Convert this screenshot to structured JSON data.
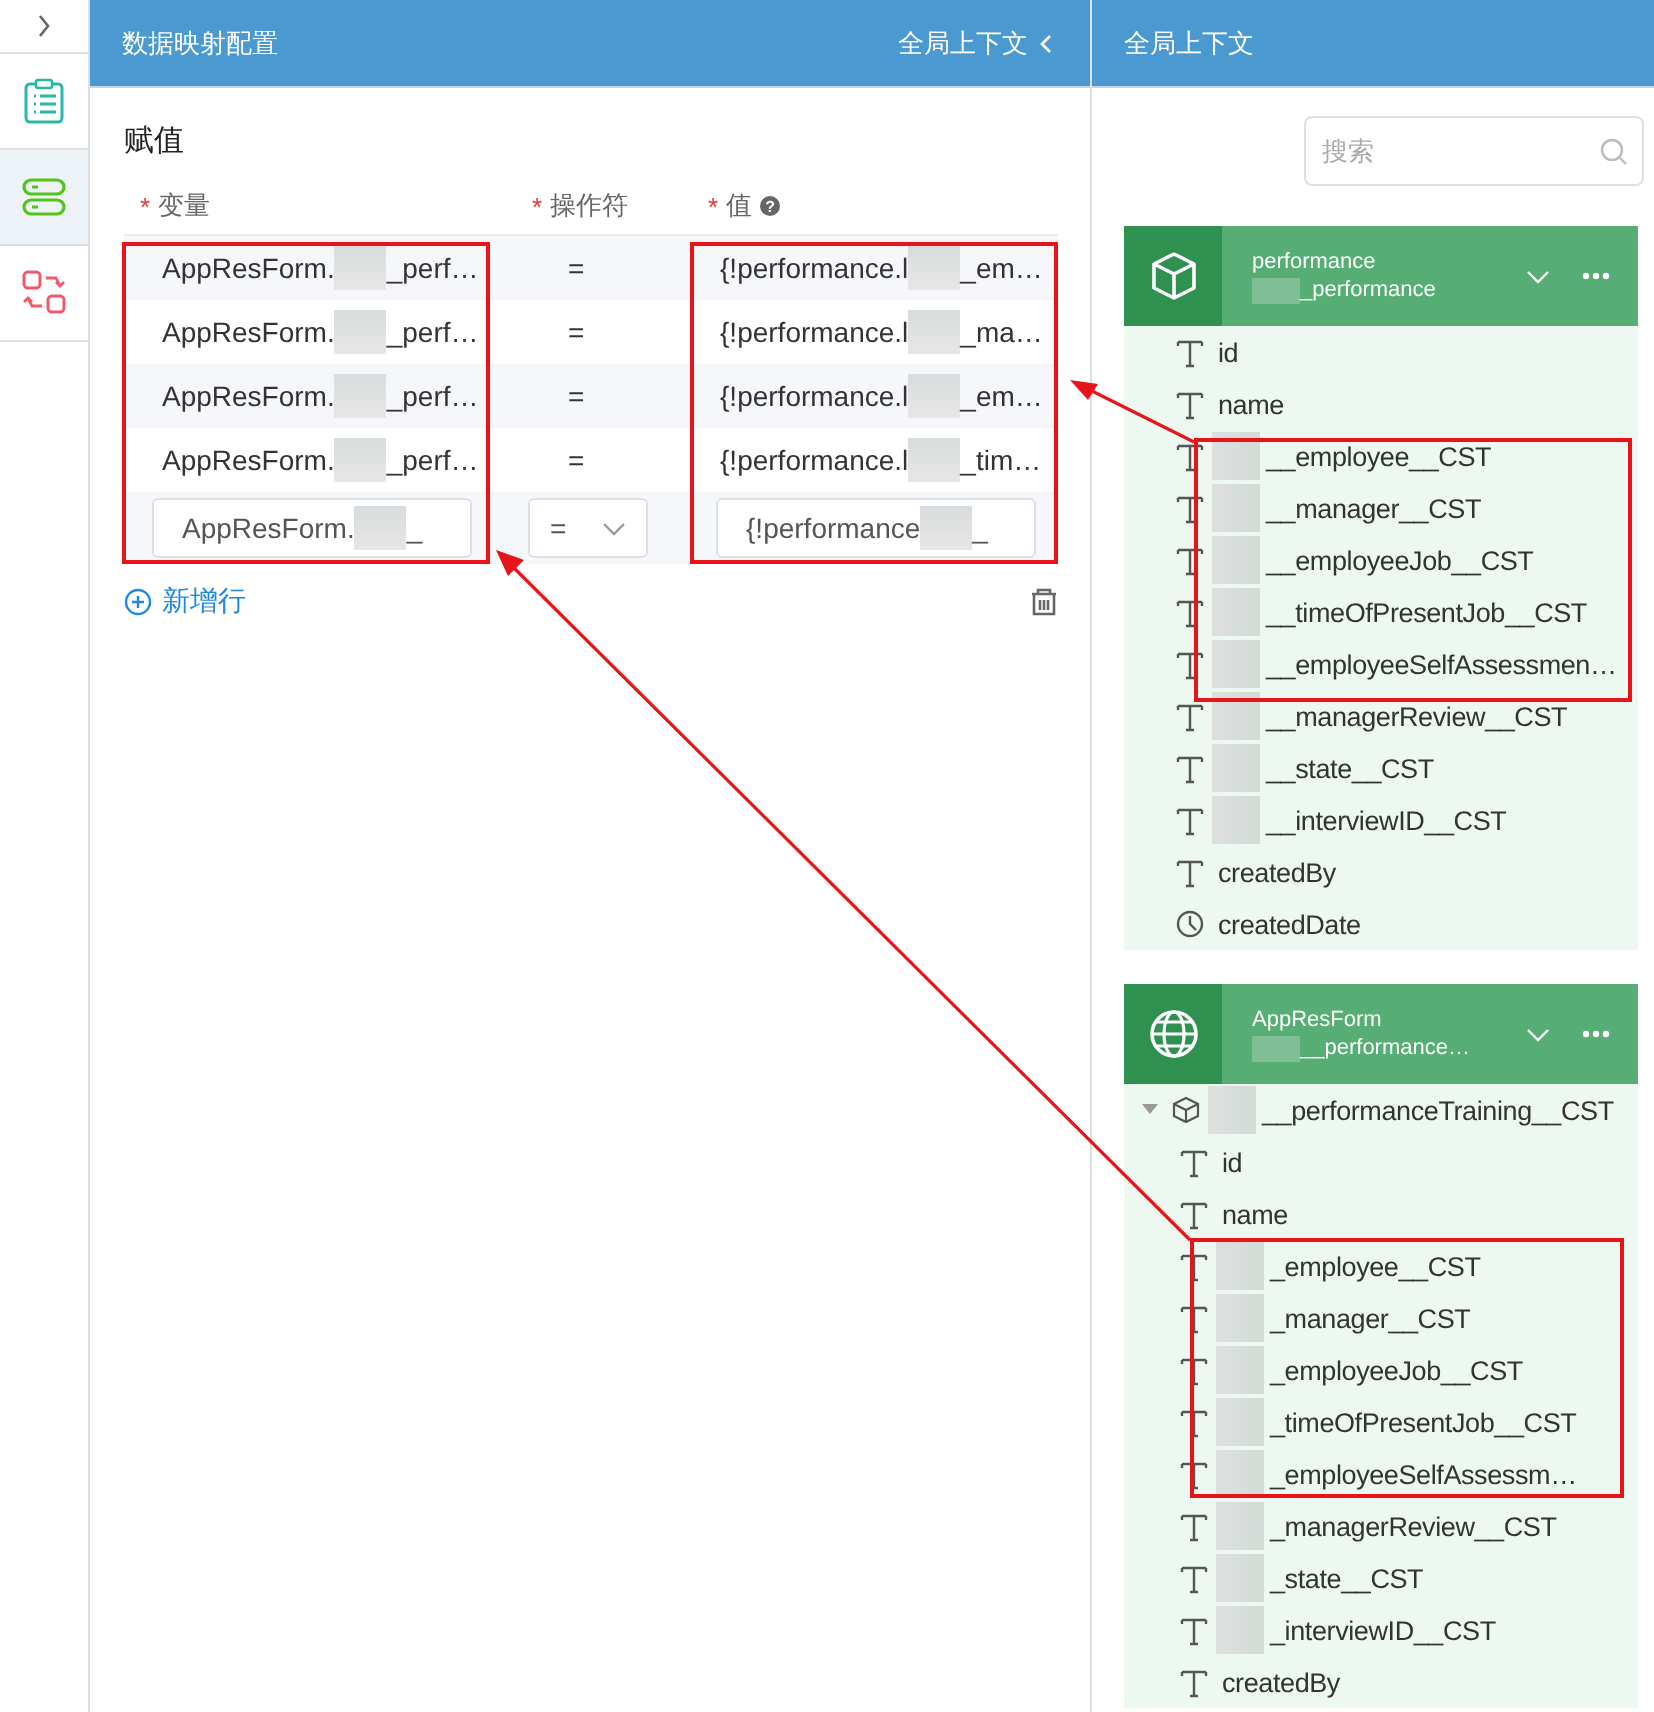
{
  "sidebar": {
    "items": [
      {
        "kind": "list",
        "selected": false
      },
      {
        "kind": "toggle",
        "selected": true
      },
      {
        "kind": "swap",
        "selected": false
      }
    ]
  },
  "mapping": {
    "title": "数据映射配置",
    "context_link": "全局上下文",
    "section": "赋值",
    "columns": [
      {
        "marker": "*",
        "label": "变量"
      },
      {
        "marker": "*",
        "label": "操作符"
      },
      {
        "marker": "*",
        "label": "值",
        "help": "?"
      }
    ],
    "rows": [
      {
        "variable_prefix": "AppResForm.",
        "variable_suffix": "_perf…",
        "operator": "=",
        "value_prefix": "{!performance.l",
        "value_suffix": "_em…"
      },
      {
        "variable_prefix": "AppResForm.",
        "variable_suffix": "_perf…",
        "operator": "=",
        "value_prefix": "{!performance.l",
        "value_suffix": "_ma…"
      },
      {
        "variable_prefix": "AppResForm.",
        "variable_suffix": "_perf…",
        "operator": "=",
        "value_prefix": "{!performance.l",
        "value_suffix": "_em…"
      },
      {
        "variable_prefix": "AppResForm.",
        "variable_suffix": "_perf…",
        "operator": "=",
        "value_prefix": "{!performance.l",
        "value_suffix": "_tim…"
      }
    ],
    "edit_row": {
      "variable_prefix": "AppResForm.",
      "variable_suffix": "_",
      "operator": "=",
      "value_prefix": "{!performance",
      "value_suffix": "_"
    },
    "add_row": "新增行"
  },
  "context": {
    "title": "全局上下文",
    "search": {
      "placeholder": "搜索"
    },
    "cards": [
      {
        "kind": "object",
        "title": "performance",
        "subtitle": "_performance",
        "fields": [
          {
            "kind": "text",
            "masked": false,
            "label": "id"
          },
          {
            "kind": "text",
            "masked": false,
            "label": "name"
          },
          {
            "kind": "text",
            "masked": true,
            "label": "__employee__CST"
          },
          {
            "kind": "text",
            "masked": true,
            "label": "__manager__CST"
          },
          {
            "kind": "text",
            "masked": true,
            "label": "__employeeJob__CST"
          },
          {
            "kind": "text",
            "masked": true,
            "label": "__timeOfPresentJob__CST"
          },
          {
            "kind": "text",
            "masked": true,
            "label": "__employeeSelfAssessmen…"
          },
          {
            "kind": "text",
            "masked": true,
            "label": "__managerReview__CST"
          },
          {
            "kind": "text",
            "masked": true,
            "label": "__state__CST"
          },
          {
            "kind": "text",
            "masked": true,
            "label": "__interviewID__CST"
          },
          {
            "kind": "text",
            "masked": false,
            "label": "createdBy"
          },
          {
            "kind": "date",
            "masked": false,
            "label": "createdDate"
          }
        ]
      },
      {
        "kind": "form",
        "title": "AppResForm",
        "subtitle": "__performance…",
        "fields": [
          {
            "kind": "object",
            "masked": true,
            "label": "__performanceTraining__CST",
            "expanded": true,
            "children": [
              {
                "kind": "text",
                "masked": false,
                "label": "id"
              },
              {
                "kind": "text",
                "masked": false,
                "label": "name"
              },
              {
                "kind": "text",
                "masked": true,
                "label": "_employee__CST"
              },
              {
                "kind": "text",
                "masked": true,
                "label": "_manager__CST"
              },
              {
                "kind": "text",
                "masked": true,
                "label": "_employeeJob__CST"
              },
              {
                "kind": "text",
                "masked": true,
                "label": "_timeOfPresentJob__CST"
              },
              {
                "kind": "text",
                "masked": true,
                "label": "_employeeSelfAssessm…"
              },
              {
                "kind": "text",
                "masked": true,
                "label": "_managerReview__CST"
              },
              {
                "kind": "text",
                "masked": true,
                "label": "_state__CST"
              },
              {
                "kind": "text",
                "masked": true,
                "label": "_interviewID__CST"
              },
              {
                "kind": "text",
                "masked": false,
                "label": "createdBy"
              }
            ]
          }
        ]
      }
    ]
  }
}
